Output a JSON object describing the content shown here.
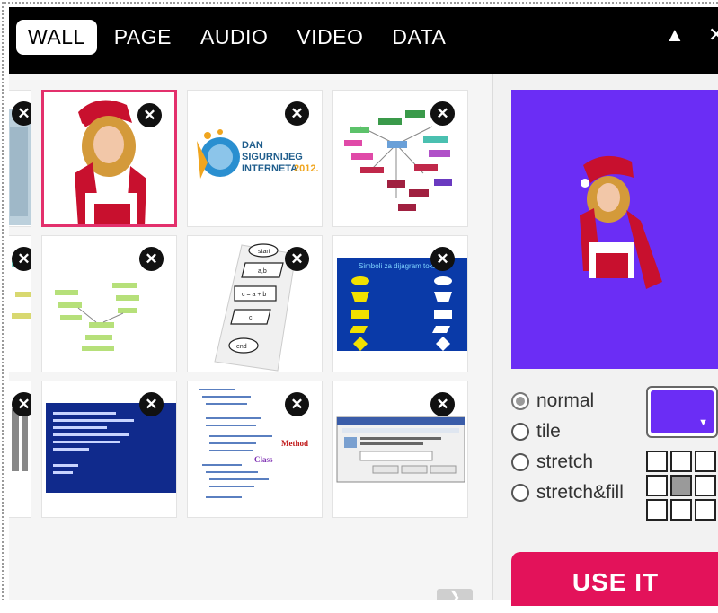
{
  "tabs": [
    {
      "label": "WALL",
      "active": true
    },
    {
      "label": "PAGE"
    },
    {
      "label": "AUDIO"
    },
    {
      "label": "VIDEO"
    },
    {
      "label": "DATA"
    }
  ],
  "window_controls": {
    "collapse": "▲",
    "close": "✕"
  },
  "gallery": {
    "close_glyph": "✕",
    "tiles": [
      {
        "name": "partial-photo-tile"
      },
      {
        "name": "santa-girl-photo-tile",
        "selected": true
      },
      {
        "name": "dan-sigurnijeg-interneta-tile",
        "text": [
          "DAN",
          "SIGURNIJEG",
          "INTERNETA",
          "2012."
        ]
      },
      {
        "name": "mind-map-tile"
      },
      {
        "name": "partial-mindmap-tile"
      },
      {
        "name": "flowchart-green-tile"
      },
      {
        "name": "flowchart-diagram-tile",
        "text": [
          "start",
          "a,b",
          "c = a + b",
          "c",
          "end"
        ]
      },
      {
        "name": "flowchart-symbols-tile",
        "text": [
          "Simboli za dijagram toka"
        ]
      },
      {
        "name": "partial-text-tile"
      },
      {
        "name": "dos-screen-tile"
      },
      {
        "name": "code-listing-tile",
        "text": [
          "Method",
          "Class"
        ]
      },
      {
        "name": "dialog-screenshot-tile"
      }
    ]
  },
  "scroll_arrow": "❯",
  "sidebar": {
    "background_color": "#6b2df5",
    "modes": [
      {
        "label": "normal",
        "checked": true
      },
      {
        "label": "tile"
      },
      {
        "label": "stretch"
      },
      {
        "label": "stretch&fill"
      }
    ],
    "color_caret": "▼",
    "alignment": {
      "rows": 3,
      "cols": 3,
      "active_index": 4
    },
    "use_button": "USE IT"
  }
}
